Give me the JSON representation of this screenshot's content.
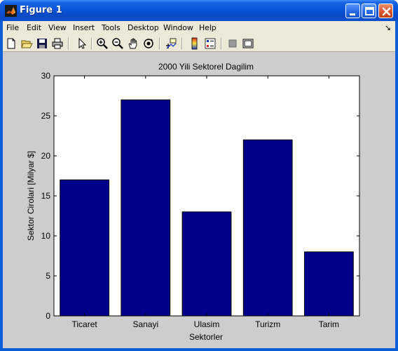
{
  "window": {
    "title": "Figure 1"
  },
  "menubar": {
    "items": [
      "File",
      "Edit",
      "View",
      "Insert",
      "Tools",
      "Desktop",
      "Window",
      "Help"
    ],
    "dock_arrow": "↘"
  },
  "toolbar": {
    "tools": [
      {
        "name": "new-figure-icon"
      },
      {
        "name": "open-file-icon"
      },
      {
        "name": "save-icon"
      },
      {
        "name": "print-icon"
      },
      {
        "name": "edit-plot-arrow-icon"
      },
      {
        "name": "zoom-in-icon"
      },
      {
        "name": "zoom-out-icon"
      },
      {
        "name": "pan-hand-icon"
      },
      {
        "name": "rotate-3d-icon"
      },
      {
        "name": "data-cursor-icon"
      },
      {
        "name": "insert-colorbar-icon"
      },
      {
        "name": "insert-legend-icon"
      },
      {
        "name": "hide-plot-tools-icon"
      },
      {
        "name": "show-plot-tools-icon"
      }
    ]
  },
  "colors": {
    "bar_fill": "#00008b",
    "axes_background": "#ffffff",
    "figure_background": "#cdcdcd"
  },
  "chart_data": {
    "type": "bar",
    "title": "2000 Yili Sektorel Dagilim",
    "xlabel": "Sektorler",
    "ylabel": "Sektor Cirolari [Milyar $]",
    "categories": [
      "Ticaret",
      "Sanayi",
      "Ulasim",
      "Turizm",
      "Tarim"
    ],
    "values": [
      17,
      27,
      13,
      22,
      8
    ],
    "ylim": [
      0,
      30
    ],
    "yticks": [
      0,
      5,
      10,
      15,
      20,
      25,
      30
    ],
    "grid": false,
    "legend": "none"
  }
}
